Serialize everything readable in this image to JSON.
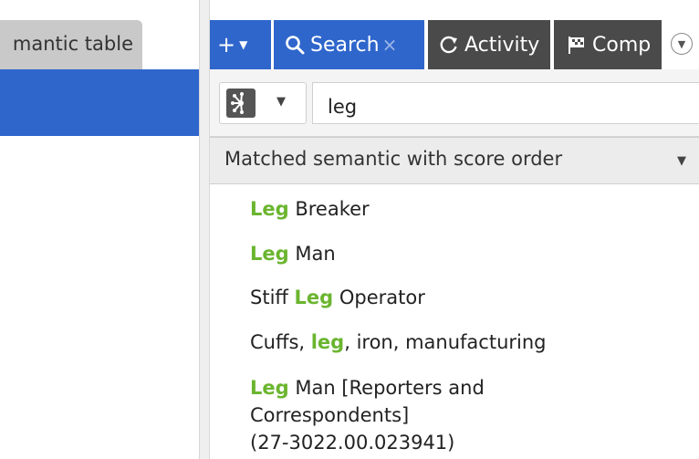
{
  "left_panel": {
    "tab_label": "mantic table"
  },
  "tabs": {
    "add_label": "+",
    "search_label": "Search",
    "search_close": "×",
    "activity_label": "Activity",
    "comp_label": "Comp"
  },
  "search": {
    "query": "leg"
  },
  "order": {
    "selected": "Matched semantic with score order"
  },
  "results": [
    {
      "prefix": "",
      "match": "Leg",
      "suffix": " Breaker"
    },
    {
      "prefix": "",
      "match": "Leg",
      "suffix": " Man"
    },
    {
      "prefix": "Stiff ",
      "match": "Leg",
      "suffix": " Operator"
    },
    {
      "prefix": "Cuffs, ",
      "match": "leg",
      "suffix": ", iron, manufacturing"
    },
    {
      "prefix": "",
      "match": "Leg",
      "suffix": " Man [Reporters and",
      "line2": "Correspondents]",
      "line3": "(27-3022.00.023941)"
    }
  ],
  "colors": {
    "accent_blue": "#2f66cc",
    "match_green": "#6bb52f",
    "dark_tab": "#4a4a4a"
  },
  "icons": {
    "search_tab": "search-icon",
    "activity_tab": "refresh-icon",
    "comp_tab": "flag-icon",
    "scope": "network-icon"
  }
}
